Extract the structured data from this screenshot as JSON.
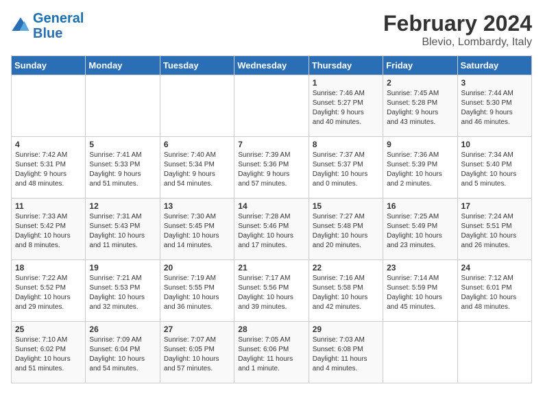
{
  "header": {
    "logo_general": "General",
    "logo_blue": "Blue",
    "title": "February 2024",
    "subtitle": "Blevio, Lombardy, Italy"
  },
  "days_of_week": [
    "Sunday",
    "Monday",
    "Tuesday",
    "Wednesday",
    "Thursday",
    "Friday",
    "Saturday"
  ],
  "weeks": [
    [
      {
        "day": "",
        "info": ""
      },
      {
        "day": "",
        "info": ""
      },
      {
        "day": "",
        "info": ""
      },
      {
        "day": "",
        "info": ""
      },
      {
        "day": "1",
        "info": "Sunrise: 7:46 AM\nSunset: 5:27 PM\nDaylight: 9 hours\nand 40 minutes."
      },
      {
        "day": "2",
        "info": "Sunrise: 7:45 AM\nSunset: 5:28 PM\nDaylight: 9 hours\nand 43 minutes."
      },
      {
        "day": "3",
        "info": "Sunrise: 7:44 AM\nSunset: 5:30 PM\nDaylight: 9 hours\nand 46 minutes."
      }
    ],
    [
      {
        "day": "4",
        "info": "Sunrise: 7:42 AM\nSunset: 5:31 PM\nDaylight: 9 hours\nand 48 minutes."
      },
      {
        "day": "5",
        "info": "Sunrise: 7:41 AM\nSunset: 5:33 PM\nDaylight: 9 hours\nand 51 minutes."
      },
      {
        "day": "6",
        "info": "Sunrise: 7:40 AM\nSunset: 5:34 PM\nDaylight: 9 hours\nand 54 minutes."
      },
      {
        "day": "7",
        "info": "Sunrise: 7:39 AM\nSunset: 5:36 PM\nDaylight: 9 hours\nand 57 minutes."
      },
      {
        "day": "8",
        "info": "Sunrise: 7:37 AM\nSunset: 5:37 PM\nDaylight: 10 hours\nand 0 minutes."
      },
      {
        "day": "9",
        "info": "Sunrise: 7:36 AM\nSunset: 5:39 PM\nDaylight: 10 hours\nand 2 minutes."
      },
      {
        "day": "10",
        "info": "Sunrise: 7:34 AM\nSunset: 5:40 PM\nDaylight: 10 hours\nand 5 minutes."
      }
    ],
    [
      {
        "day": "11",
        "info": "Sunrise: 7:33 AM\nSunset: 5:42 PM\nDaylight: 10 hours\nand 8 minutes."
      },
      {
        "day": "12",
        "info": "Sunrise: 7:31 AM\nSunset: 5:43 PM\nDaylight: 10 hours\nand 11 minutes."
      },
      {
        "day": "13",
        "info": "Sunrise: 7:30 AM\nSunset: 5:45 PM\nDaylight: 10 hours\nand 14 minutes."
      },
      {
        "day": "14",
        "info": "Sunrise: 7:28 AM\nSunset: 5:46 PM\nDaylight: 10 hours\nand 17 minutes."
      },
      {
        "day": "15",
        "info": "Sunrise: 7:27 AM\nSunset: 5:48 PM\nDaylight: 10 hours\nand 20 minutes."
      },
      {
        "day": "16",
        "info": "Sunrise: 7:25 AM\nSunset: 5:49 PM\nDaylight: 10 hours\nand 23 minutes."
      },
      {
        "day": "17",
        "info": "Sunrise: 7:24 AM\nSunset: 5:51 PM\nDaylight: 10 hours\nand 26 minutes."
      }
    ],
    [
      {
        "day": "18",
        "info": "Sunrise: 7:22 AM\nSunset: 5:52 PM\nDaylight: 10 hours\nand 29 minutes."
      },
      {
        "day": "19",
        "info": "Sunrise: 7:21 AM\nSunset: 5:53 PM\nDaylight: 10 hours\nand 32 minutes."
      },
      {
        "day": "20",
        "info": "Sunrise: 7:19 AM\nSunset: 5:55 PM\nDaylight: 10 hours\nand 36 minutes."
      },
      {
        "day": "21",
        "info": "Sunrise: 7:17 AM\nSunset: 5:56 PM\nDaylight: 10 hours\nand 39 minutes."
      },
      {
        "day": "22",
        "info": "Sunrise: 7:16 AM\nSunset: 5:58 PM\nDaylight: 10 hours\nand 42 minutes."
      },
      {
        "day": "23",
        "info": "Sunrise: 7:14 AM\nSunset: 5:59 PM\nDaylight: 10 hours\nand 45 minutes."
      },
      {
        "day": "24",
        "info": "Sunrise: 7:12 AM\nSunset: 6:01 PM\nDaylight: 10 hours\nand 48 minutes."
      }
    ],
    [
      {
        "day": "25",
        "info": "Sunrise: 7:10 AM\nSunset: 6:02 PM\nDaylight: 10 hours\nand 51 minutes."
      },
      {
        "day": "26",
        "info": "Sunrise: 7:09 AM\nSunset: 6:04 PM\nDaylight: 10 hours\nand 54 minutes."
      },
      {
        "day": "27",
        "info": "Sunrise: 7:07 AM\nSunset: 6:05 PM\nDaylight: 10 hours\nand 57 minutes."
      },
      {
        "day": "28",
        "info": "Sunrise: 7:05 AM\nSunset: 6:06 PM\nDaylight: 11 hours\nand 1 minute."
      },
      {
        "day": "29",
        "info": "Sunrise: 7:03 AM\nSunset: 6:08 PM\nDaylight: 11 hours\nand 4 minutes."
      },
      {
        "day": "",
        "info": ""
      },
      {
        "day": "",
        "info": ""
      }
    ]
  ]
}
